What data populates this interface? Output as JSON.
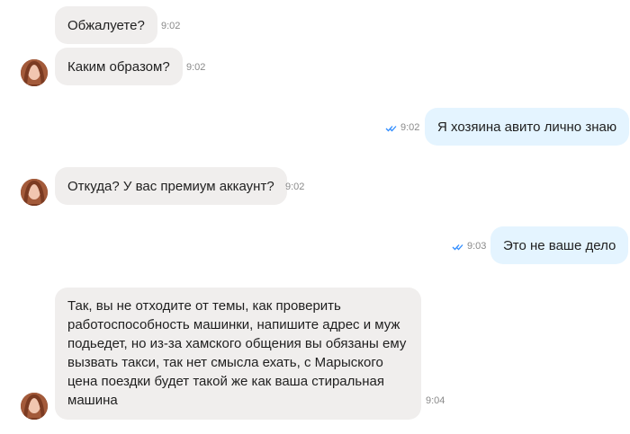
{
  "messages": [
    {
      "text": "Обжалуете?",
      "time": "9:02"
    },
    {
      "text": "Каким образом?",
      "time": "9:02"
    },
    {
      "text": "Я хозяина авито лично знаю",
      "time": "9:02"
    },
    {
      "text": "Откуда? У вас премиум аккаунт?",
      "time": "9:02"
    },
    {
      "text": "Это не ваше дело",
      "time": "9:03"
    },
    {
      "text": "Так, вы не отходите от темы, как проверить работоспособность машинки, напишите адрес и муж подьедет, но из-за хамского общения вы обязаны ему вызвать такси, так нет смысла ехать, с Марыского цена поездки будет такой же как ваша стиральная машина",
      "time": "9:04"
    }
  ],
  "colors": {
    "incoming_bubble": "#f0eeed",
    "outgoing_bubble": "#e4f4ff",
    "read_check": "#2f8cff"
  },
  "icons": [
    "avatar",
    "double-check-icon"
  ]
}
